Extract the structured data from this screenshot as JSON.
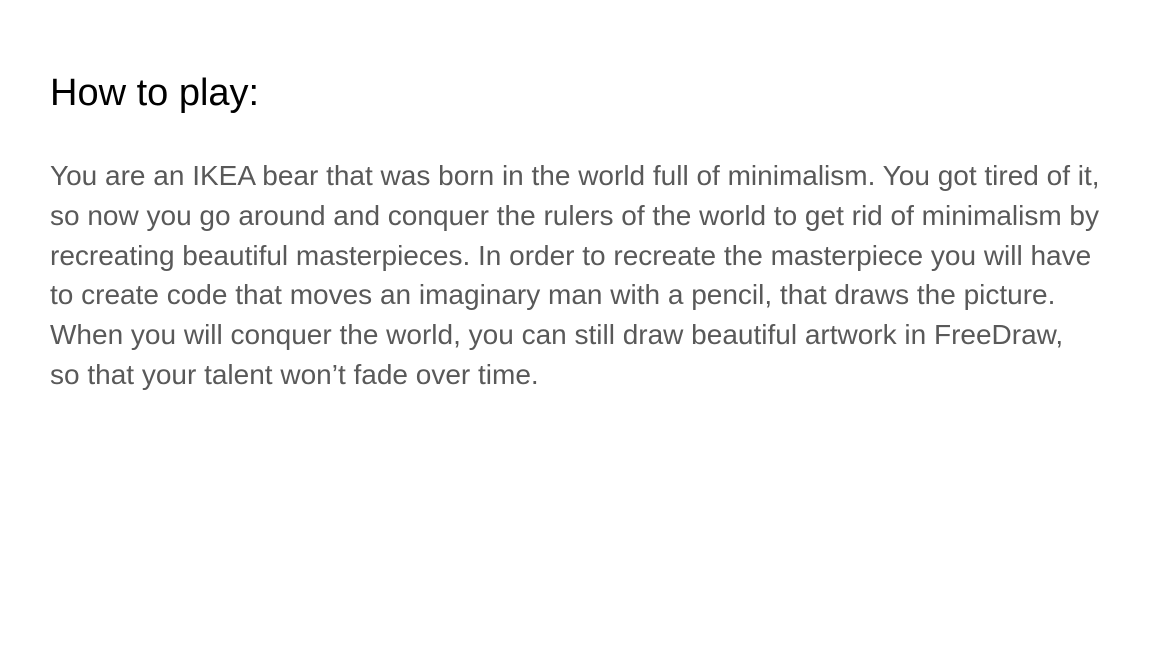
{
  "slide": {
    "title": "How to play:",
    "body": "You are an IKEA bear that was born in the world full of minimalism. You got tired of it, so now you go around and conquer the rulers of the world to get rid of minimalism by recreating beautiful masterpieces. In order to recreate the masterpiece you will have to create code that moves an imaginary man with a pencil, that draws the picture. When you will conquer the world, you can still draw beautiful artwork in FreeDraw, so that your talent won’t fade over time."
  },
  "colors": {
    "background": "#ffffff",
    "title": "#000000",
    "body": "#595959"
  }
}
